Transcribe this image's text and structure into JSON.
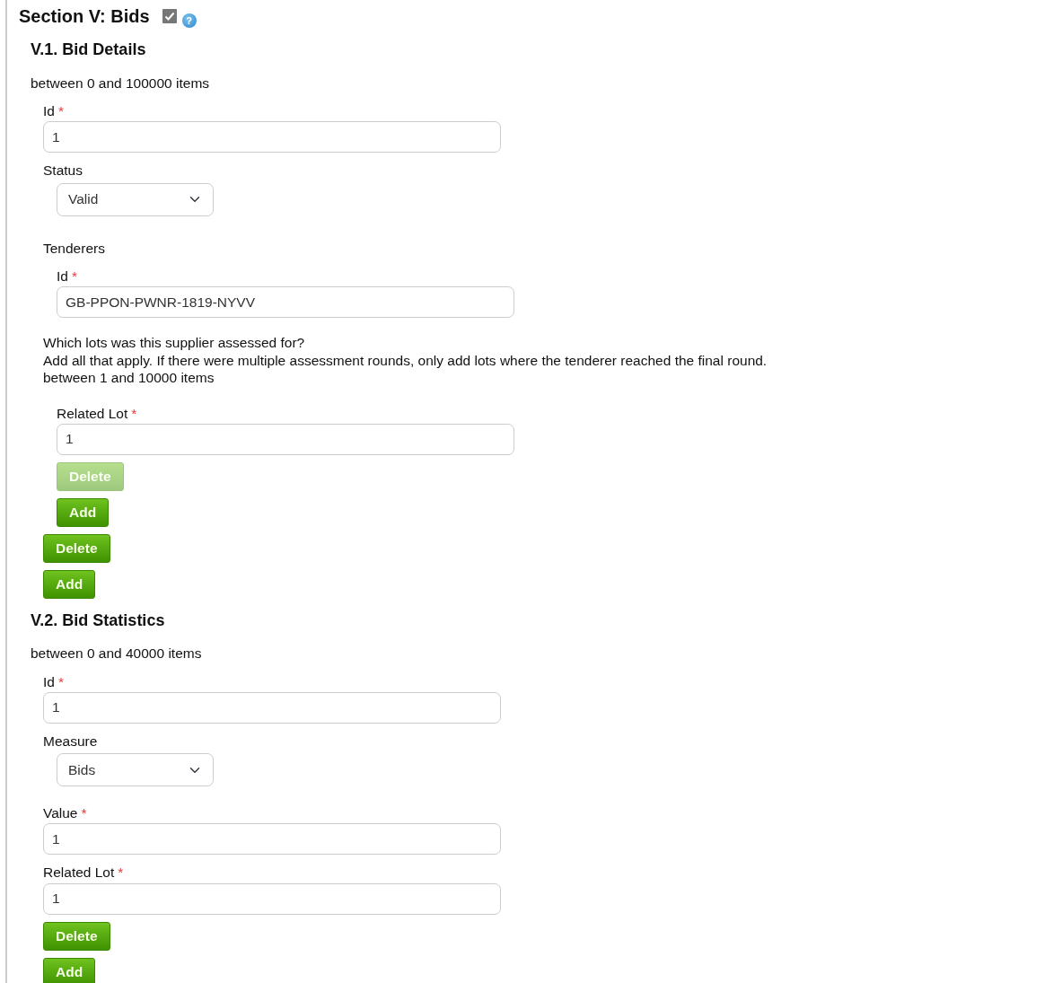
{
  "section": {
    "title": "Section V: Bids",
    "checked": true,
    "help": "?",
    "subsections": [
      {
        "title": "V.1. Bid Details",
        "note": "between 0 and 100000 items",
        "items": [
          {
            "kind": "field",
            "label": "Id",
            "required_mark": "*",
            "value": "1"
          },
          {
            "kind": "select",
            "label": "Status",
            "value": "Valid"
          },
          {
            "kind": "group",
            "label": "Tenderers",
            "children": [
              {
                "kind": "field",
                "label": "Id",
                "required_mark": "*",
                "value": "GB-PPON-PWNR-1819-NYVV"
              }
            ]
          },
          {
            "kind": "text",
            "lines": [
              "Which lots was this supplier assessed for?",
              "Add all that apply. If there were multiple assessment rounds, only add lots where the tenderer reached the final round.",
              "between 1 and 10000 items"
            ]
          },
          {
            "kind": "group",
            "children": [
              {
                "kind": "field",
                "label": "Related Lot",
                "required_mark": "*",
                "value": "1"
              },
              {
                "kind": "button",
                "label": "Delete",
                "disabled": true
              },
              {
                "kind": "button",
                "label": "Add",
                "disabled": false
              }
            ]
          },
          {
            "kind": "button",
            "label": "Delete",
            "disabled": false
          },
          {
            "kind": "button",
            "label": "Add",
            "disabled": false
          }
        ]
      },
      {
        "title": "V.2. Bid Statistics",
        "note": "between 0 and 40000 items",
        "items": [
          {
            "kind": "field",
            "label": "Id",
            "required_mark": "*",
            "value": "1"
          },
          {
            "kind": "select",
            "label": "Measure",
            "value": "Bids"
          },
          {
            "kind": "field",
            "label": "Value",
            "required_mark": "*",
            "value": "1"
          },
          {
            "kind": "field",
            "label": "Related Lot",
            "required_mark": "*",
            "value": "1"
          },
          {
            "kind": "button",
            "label": "Delete",
            "disabled": false
          },
          {
            "kind": "button",
            "label": "Add",
            "disabled": false
          }
        ]
      }
    ]
  }
}
